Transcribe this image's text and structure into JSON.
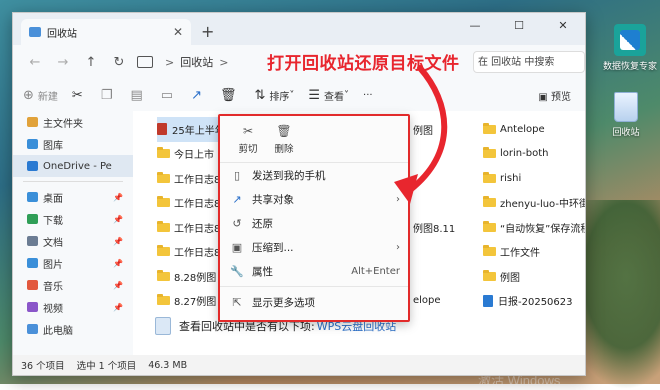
{
  "desktop": {
    "icons": [
      {
        "label": "数据恢复专家",
        "icon": "data-recovery-icon"
      },
      {
        "label": "回收站",
        "icon": "recycle-bin-icon"
      }
    ],
    "watermark": "激活 Windows"
  },
  "window": {
    "tab_title": "回收站",
    "new_tab": "+",
    "controls": {
      "minimize": "—",
      "maximize": "☐",
      "close": "✕"
    }
  },
  "nav": {
    "back": "←",
    "forward": "→",
    "up": "↑",
    "refresh": "↻"
  },
  "address": {
    "location": "回收站",
    "chevron": ">"
  },
  "annotation": "打开回收站还原目标文件",
  "search": {
    "placeholder": "在 回收站 中搜索"
  },
  "toolbar": {
    "new_label": "新建",
    "sort_label": "排序",
    "view_label": "查看",
    "more": "···",
    "preview_label": "预览"
  },
  "sidebar": {
    "items": [
      {
        "label": "主文件夹",
        "color": "#e1a23a"
      },
      {
        "label": "图库",
        "color": "#3a8fd9"
      },
      {
        "label": "OneDrive - Pe",
        "color": "#2a7ad2"
      },
      {
        "label": "桌面",
        "color": "#3a8fd9"
      },
      {
        "label": "下载",
        "color": "#2f9e57"
      },
      {
        "label": "文档",
        "color": "#6b7c93"
      },
      {
        "label": "图片",
        "color": "#3a8fd9"
      },
      {
        "label": "音乐",
        "color": "#e2583e"
      },
      {
        "label": "视频",
        "color": "#8a56c9"
      },
      {
        "label": "此电脑",
        "color": "#4a90d9"
      }
    ]
  },
  "files": {
    "col1": [
      "25年上半年",
      "今日上市",
      "工作日志8.",
      "工作日志8.",
      "工作日志8.",
      "工作日志8.",
      "8.28例图",
      "8.27例图"
    ],
    "col2": [
      "例图",
      "",
      "",
      "",
      "例图8.11",
      "",
      "",
      "elope"
    ],
    "col3": [
      "Antelope",
      "lorin-both",
      "rishi",
      "zhenyu-luo-中环街",
      "“自动恢复”保存流程",
      "工作文件",
      "例图",
      "日报-20250623"
    ]
  },
  "context_menu": {
    "quick": [
      {
        "label": "剪切",
        "icon": "scissors-icon"
      },
      {
        "label": "删除",
        "icon": "trash-icon"
      }
    ],
    "items": [
      {
        "label": "发送到我的手机",
        "shortcut": ""
      },
      {
        "label": "共享对象",
        "shortcut": "›"
      },
      {
        "label": "还原",
        "shortcut": ""
      },
      {
        "label": "压缩到...",
        "shortcut": "›"
      },
      {
        "label": "属性",
        "shortcut": "Alt+Enter"
      },
      {
        "label": "显示更多选项",
        "shortcut": ""
      }
    ]
  },
  "hint": {
    "text": "查看回收站中是否有以下项:",
    "link": "WPS云盘回收站"
  },
  "status": {
    "count": "36 个项目",
    "selected": "选中 1 个项目",
    "size": "46.3 MB"
  },
  "colors": {
    "annotation": "#e8262e",
    "accent": "#2a6fc9",
    "folder": "#f3c53b"
  }
}
